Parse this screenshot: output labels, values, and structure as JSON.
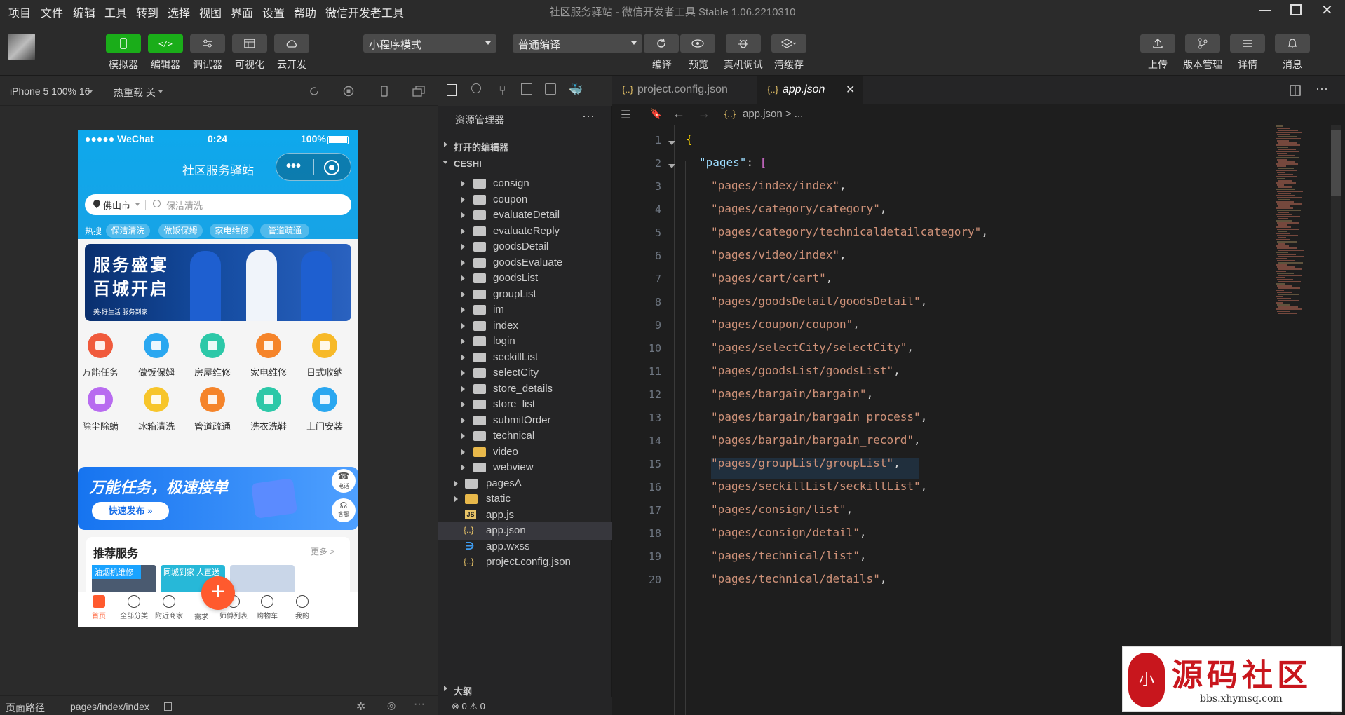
{
  "menu": [
    "项目",
    "文件",
    "编辑",
    "工具",
    "转到",
    "选择",
    "视图",
    "界面",
    "设置",
    "帮助",
    "微信开发者工具"
  ],
  "window_title": "社区服务驿站 - 微信开发者工具 Stable 1.06.2210310",
  "toolbar": {
    "left": [
      {
        "label": "模拟器",
        "color": "#1aad19"
      },
      {
        "label": "编辑器",
        "color": "#1aad19"
      },
      {
        "label": "调试器",
        "color": "#4a4a4a"
      },
      {
        "label": "可视化",
        "color": "#4a4a4a"
      },
      {
        "label": "云开发",
        "color": "#4a4a4a"
      }
    ],
    "mode_select": "小程序模式",
    "compile_select": "普通编译",
    "middle": [
      "编译",
      "预览",
      "真机调试",
      "清缓存"
    ],
    "right": [
      "上传",
      "版本管理",
      "详情",
      "消息"
    ]
  },
  "simulator": {
    "device": "iPhone 5 100% 16",
    "hot_reload": "热重载 关",
    "footer_label": "页面路径",
    "footer_path": "pages/index/index"
  },
  "phone": {
    "carrier": "●●●●● WeChat",
    "time": "0:24",
    "battery": "100%",
    "title": "社区服务驿站",
    "city": "佛山市",
    "search_placeholder": "保洁清洗",
    "hot_label": "热搜",
    "hot_tags": [
      "保洁清洗",
      "做饭保姆",
      "家电维修",
      "管道疏通"
    ],
    "banner_line1": "服务盛宴",
    "banner_line2": "百城开启",
    "banner_small": "美·好生活 服务到家",
    "categories_row1": [
      {
        "label": "万能任务",
        "color": "#f05a3c"
      },
      {
        "label": "做饭保姆",
        "color": "#2aa7f0"
      },
      {
        "label": "房屋维修",
        "color": "#2cc8a8"
      },
      {
        "label": "家电维修",
        "color": "#f5842a"
      },
      {
        "label": "日式收纳",
        "color": "#f7b928"
      }
    ],
    "categories_row2": [
      {
        "label": "除尘除螨",
        "color": "#b86bf0"
      },
      {
        "label": "冰箱清洗",
        "color": "#f7c52a"
      },
      {
        "label": "管道疏通",
        "color": "#f5842a"
      },
      {
        "label": "洗衣洗鞋",
        "color": "#2cc8a8"
      },
      {
        "label": "上门安装",
        "color": "#2aa7f0"
      }
    ],
    "promo_title": "万能任务，极速接单",
    "promo_button": "快速发布 »",
    "side_phone": "电话",
    "side_service": "客服",
    "recommend_title": "推荐服务",
    "recommend_more": "更多 >",
    "recommend_card1": "油烟机维修",
    "recommend_card2": "同城到家 人直送",
    "tabs": [
      "首页",
      "全部分类",
      "附近商家",
      "需求",
      "师傅列表",
      "购物车",
      "我的"
    ]
  },
  "explorer": {
    "title": "资源管理器",
    "open_editors": "打开的编辑器",
    "project": "CESHI",
    "folders": [
      "consign",
      "coupon",
      "evaluateDetail",
      "evaluateReply",
      "goodsDetail",
      "goodsEvaluate",
      "goodsList",
      "groupList",
      "im",
      "index",
      "login",
      "seckillList",
      "selectCity",
      "store_details",
      "store_list",
      "submitOrder",
      "technical",
      "video",
      "webview"
    ],
    "root_items": [
      "pagesA",
      "static",
      "app.js",
      "app.json",
      "app.wxss",
      "project.config.json"
    ],
    "outline": "大纲",
    "status": "⊗ 0 ⚠ 0"
  },
  "editor": {
    "tabs": [
      "project.config.json",
      "app.json"
    ],
    "breadcrumb": "app.json > ...",
    "lines": [
      {
        "n": "1",
        "text": "{",
        "type": "open"
      },
      {
        "n": "2",
        "text": "\"pages\": [",
        "type": "key"
      },
      {
        "n": "3",
        "text": "\"pages/index/index\",",
        "type": "str"
      },
      {
        "n": "4",
        "text": "\"pages/category/category\",",
        "type": "str"
      },
      {
        "n": "5",
        "text": "\"pages/category/technicaldetailcategory\",",
        "type": "str"
      },
      {
        "n": "6",
        "text": "\"pages/video/index\",",
        "type": "str"
      },
      {
        "n": "7",
        "text": "\"pages/cart/cart\",",
        "type": "str"
      },
      {
        "n": "8",
        "text": "\"pages/goodsDetail/goodsDetail\",",
        "type": "str"
      },
      {
        "n": "9",
        "text": "\"pages/coupon/coupon\",",
        "type": "str"
      },
      {
        "n": "10",
        "text": "\"pages/selectCity/selectCity\",",
        "type": "str"
      },
      {
        "n": "11",
        "text": "\"pages/goodsList/goodsList\",",
        "type": "str"
      },
      {
        "n": "12",
        "text": "\"pages/bargain/bargain\",",
        "type": "str"
      },
      {
        "n": "13",
        "text": "\"pages/bargain/bargain_process\",",
        "type": "str"
      },
      {
        "n": "14",
        "text": "\"pages/bargain/bargain_record\",",
        "type": "str"
      },
      {
        "n": "15",
        "text": "\"pages/groupList/groupList\",",
        "type": "str"
      },
      {
        "n": "16",
        "text": "\"pages/seckillList/seckillList\",",
        "type": "str"
      },
      {
        "n": "17",
        "text": "\"pages/consign/list\",",
        "type": "str"
      },
      {
        "n": "18",
        "text": "\"pages/consign/detail\",",
        "type": "str"
      },
      {
        "n": "19",
        "text": "\"pages/technical/list\",",
        "type": "str"
      },
      {
        "n": "20",
        "text": "\"pages/technical/details\",",
        "type": "str"
      }
    ]
  },
  "watermark": {
    "title": "源码社区",
    "url": "bbs.xhymsq.com"
  }
}
